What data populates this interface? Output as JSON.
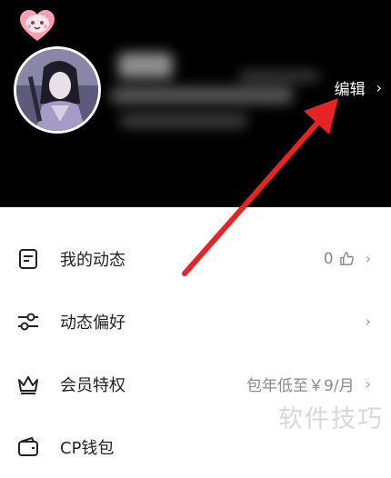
{
  "header": {
    "edit_label": "编辑",
    "chevron": "›",
    "avatar_alt": "user avatar"
  },
  "menu": {
    "items": [
      {
        "label": "我的动态",
        "value": "0",
        "icon": "document-icon",
        "has_thumb": true
      },
      {
        "label": "动态偏好",
        "value": "",
        "icon": "sliders-icon"
      },
      {
        "label": "会员特权",
        "value": "包年低至￥9/月",
        "icon": "crown-icon"
      },
      {
        "label": "CP钱包",
        "value": "",
        "icon": "wallet-icon"
      }
    ]
  },
  "watermark": "软件技巧",
  "colors": {
    "header_bg": "#000000",
    "annotation_arrow": "#e82323",
    "text_primary": "#222222",
    "text_secondary": "#8a8a8a"
  }
}
